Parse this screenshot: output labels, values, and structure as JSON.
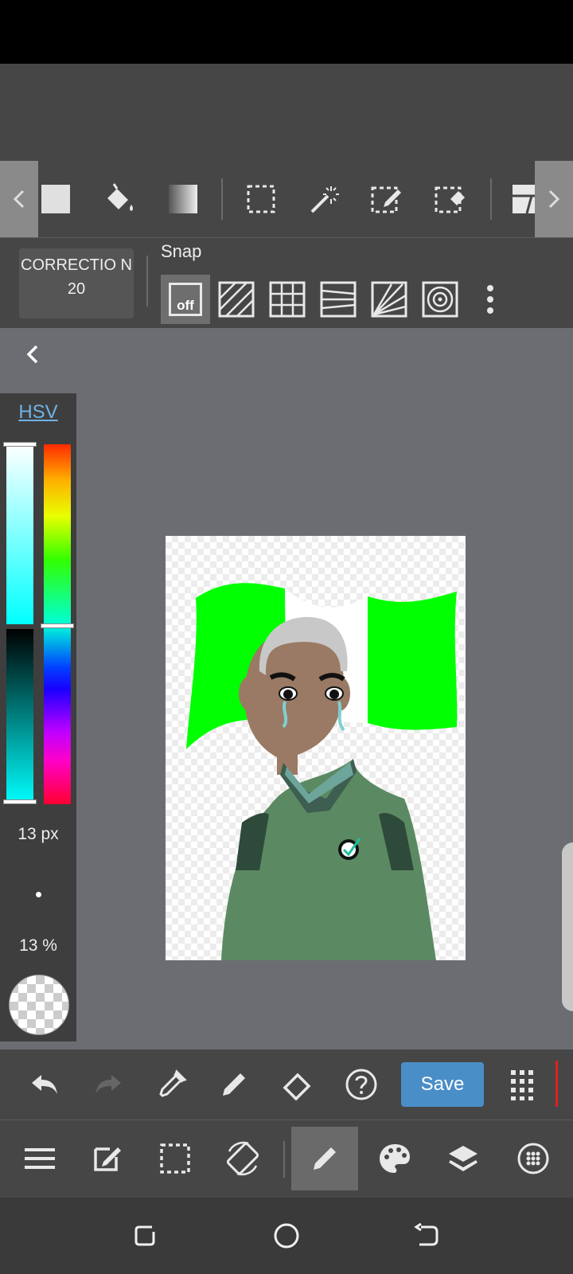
{
  "toolbar": {
    "scroll_left_icon": "chevron-left-icon",
    "scroll_right_icon": "chevron-right-icon",
    "tools": [
      "fill-rect-icon",
      "bucket-icon",
      "gradient-icon",
      "select-rect-icon",
      "magic-wand-icon",
      "select-pen-icon",
      "select-eraser-icon",
      "frame-divider-icon"
    ]
  },
  "snap": {
    "correction_label": "CORRECTIO N 20",
    "snap_label": "Snap",
    "off_label": "off"
  },
  "color_panel": {
    "mode_label": "HSV",
    "brush_size": "13 px",
    "opacity": "13 %",
    "selected_color": "#00ffff",
    "hue_fraction": 0.5,
    "saturation_fraction": 1.0,
    "brightness_fraction": 1.0
  },
  "actions": {
    "save_label": "Save",
    "icons": [
      "undo-icon",
      "redo-icon",
      "eyedropper-icon",
      "pen-icon",
      "eraser-icon",
      "help-icon",
      "grid-menu-icon"
    ]
  },
  "bottom_bar": {
    "icons": [
      "menu-icon",
      "edit-icon",
      "selection-icon",
      "rotate-icon",
      "brush-icon",
      "palette-icon",
      "layers-icon",
      "settings-dots-icon"
    ],
    "active": "brush-icon"
  },
  "nav": {
    "icons": [
      "recent-apps-icon",
      "home-icon",
      "back-icon"
    ]
  },
  "colors": {
    "accent": "#4a8ec8",
    "toolbar_bg": "#464646",
    "canvas_bg": "#6b6d72",
    "flag_green": "#00ff00",
    "shirt_green": "#5b8a62"
  }
}
